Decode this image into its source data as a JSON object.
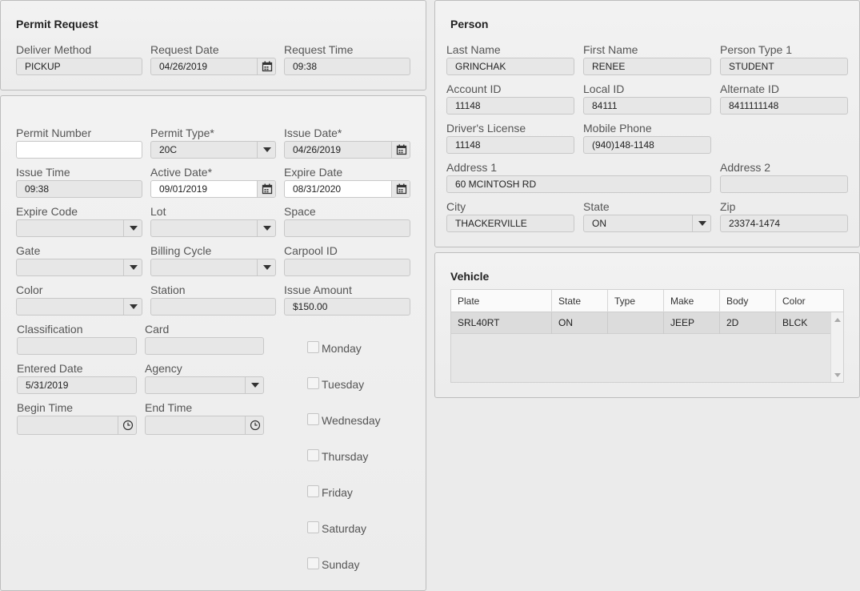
{
  "permit_request": {
    "title": "Permit Request",
    "deliver_method_label": "Deliver Method",
    "deliver_method": "PICKUP",
    "request_date_label": "Request Date",
    "request_date": "04/26/2019",
    "request_time_label": "Request Time",
    "request_time": "09:38"
  },
  "permit": {
    "permit_number_label": "Permit Number",
    "permit_number": "",
    "permit_type_label": "Permit Type*",
    "permit_type": "20C",
    "issue_date_label": "Issue Date*",
    "issue_date": "04/26/2019",
    "issue_time_label": "Issue Time",
    "issue_time": "09:38",
    "active_date_label": "Active Date*",
    "active_date": "09/01/2019",
    "expire_date_label": "Expire Date",
    "expire_date": "08/31/2020",
    "expire_code_label": "Expire Code",
    "expire_code": "",
    "lot_label": "Lot",
    "lot": "",
    "space_label": "Space",
    "space": "",
    "gate_label": "Gate",
    "gate": "",
    "billing_cycle_label": "Billing Cycle",
    "billing_cycle": "",
    "carpool_id_label": "Carpool ID",
    "carpool_id": "",
    "color_label": "Color",
    "color": "",
    "station_label": "Station",
    "station": "",
    "issue_amount_label": "Issue Amount",
    "issue_amount": "$150.00",
    "classification_label": "Classification",
    "classification": "",
    "card_label": "Card",
    "card": "",
    "entered_date_label": "Entered Date",
    "entered_date": "5/31/2019",
    "agency_label": "Agency",
    "agency": "",
    "begin_time_label": "Begin Time",
    "begin_time": "",
    "end_time_label": "End Time",
    "end_time": "",
    "days": [
      {
        "label": "Monday",
        "checked": false
      },
      {
        "label": "Tuesday",
        "checked": false
      },
      {
        "label": "Wednesday",
        "checked": false
      },
      {
        "label": "Thursday",
        "checked": false
      },
      {
        "label": "Friday",
        "checked": false
      },
      {
        "label": "Saturday",
        "checked": false
      },
      {
        "label": "Sunday",
        "checked": false
      }
    ]
  },
  "person": {
    "title": "Person",
    "last_name_label": "Last Name",
    "last_name": "GRINCHAK",
    "first_name_label": "First Name",
    "first_name": "RENEE",
    "person_type_label": "Person Type 1",
    "person_type": "STUDENT",
    "account_id_label": "Account ID",
    "account_id": "11148",
    "local_id_label": "Local ID",
    "local_id": "84111",
    "alternate_id_label": "Alternate ID",
    "alternate_id": "8411111148",
    "drivers_license_label": "Driver's License",
    "drivers_license": "11148",
    "mobile_phone_label": "Mobile Phone",
    "mobile_phone": "(940)148-1148",
    "address1_label": "Address 1",
    "address1": "60 MCINTOSH RD",
    "address2_label": "Address 2",
    "address2": "",
    "city_label": "City",
    "city": "THACKERVILLE",
    "state_label": "State",
    "state": "ON",
    "zip_label": "Zip",
    "zip": "23374-1474"
  },
  "vehicle": {
    "title": "Vehicle",
    "columns": [
      "Plate",
      "State",
      "Type",
      "Make",
      "Body",
      "Color"
    ],
    "rows": [
      [
        "SRL40RT",
        "ON",
        "",
        "JEEP",
        "2D",
        "BLCK"
      ]
    ]
  },
  "icons": {
    "calendar": "calendar-icon",
    "dropdown": "chevron-down-icon",
    "clock": "clock-icon"
  }
}
